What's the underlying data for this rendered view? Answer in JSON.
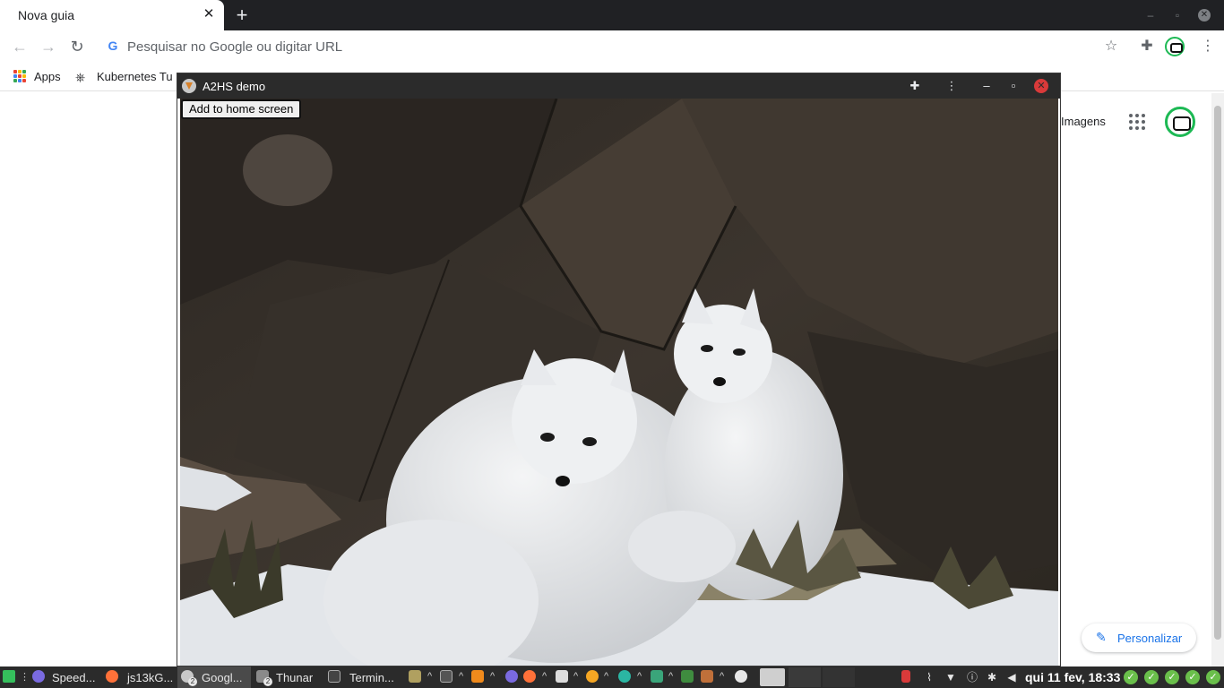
{
  "browser": {
    "tab_title": "Nova guia",
    "tab_close": "✕",
    "new_tab": "+",
    "omnibox_placeholder": "Pesquisar no Google ou digitar URL",
    "bookmarks": [
      {
        "label": "Apps"
      },
      {
        "label": "Kubernetes Tu"
      }
    ],
    "window_controls": {
      "minimize": "–",
      "restore": "▫",
      "close": "✕"
    }
  },
  "ntp": {
    "images_link": "Imagens",
    "customize_label": "Personalizar"
  },
  "pwa": {
    "title": "A2HS demo",
    "add_button": "Add to home screen",
    "controls": {
      "extensions": "extensions-icon",
      "menu": "⋮",
      "minimize": "–",
      "restore": "▫",
      "close": "✕"
    }
  },
  "taskbar": {
    "items": [
      {
        "label": "Speed...",
        "icon": "eclipse-icon"
      },
      {
        "label": "js13kG...",
        "icon": "firefox-icon"
      },
      {
        "label": "Googl...",
        "icon": "chrome-icon",
        "badge": "2"
      },
      {
        "label": "Thunar",
        "icon": "folder-icon",
        "badge": "2"
      },
      {
        "label": "Termin...",
        "icon": "terminal-icon"
      }
    ],
    "clock": "qui 11 fev, 18:33"
  },
  "colors": {
    "chrome_dark": "#202124",
    "titlebar": "#2b2b2b",
    "close_red": "#d93a3a",
    "accent_blue": "#1a73e8",
    "tray_green": "#6abf4b"
  }
}
